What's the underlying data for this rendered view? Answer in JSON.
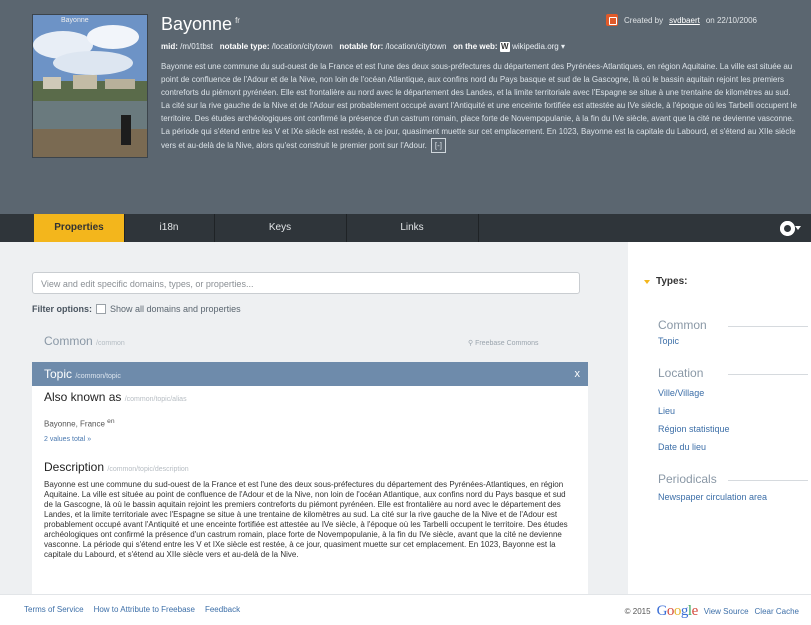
{
  "header": {
    "title": "Bayonne",
    "title_sup": "fr",
    "created_prefix": "Created by",
    "created_user": "svdbaert",
    "created_suffix": "on 22/10/2006",
    "meta": {
      "mid_label": "mid:",
      "mid_value": "/m/01tbst",
      "notable_type_label": "notable type:",
      "notable_type_value": "/location/citytown",
      "notable_for_label": "notable for:",
      "notable_for_value": "/location/citytown",
      "web_label": "on the web:",
      "web_value": "wikipedia.org"
    },
    "description": "Bayonne est une commune du sud-ouest de la France et est l'une des deux sous-préfectures du département des Pyrénées-Atlantiques, en région Aquitaine. La ville est située au point de confluence de l'Adour et de la Nive, non loin de l'océan Atlantique, aux confins nord du Pays basque et sud de la Gascogne, là où le bassin aquitain rejoint les premiers contreforts du piémont pyrénéen. Elle est frontalière au nord avec le département des Landes, et la limite territoriale avec l'Espagne se situe à une trentaine de kilomètres au sud. La cité sur la rive gauche de la Nive et de l'Adour est probablement occupé avant l'Antiquité et une enceinte fortifiée est attestée au IVe siècle, à l'époque où les Tarbelli occupent le territoire. Des études archéologiques ont confirmé la présence d'un castrum romain, place forte de Novempopulanie, à la fin du IVe siècle, avant que la cité ne devienne vasconne. La période qui s'étend entre les V et IXe siècle est restée, à ce jour, quasiment muette sur cet emplacement. En 1023, Bayonne est la capitale du Labourd, et s'étend au XIIe siècle vers et au-delà de la Nive, alors qu'est construit le premier pont sur l'Adour.",
    "more_label": "[-]"
  },
  "tabs": [
    {
      "label": "Properties",
      "active": true
    },
    {
      "label": "i18n",
      "active": false
    },
    {
      "label": "Keys",
      "active": false
    },
    {
      "label": "Links",
      "active": false
    }
  ],
  "main": {
    "search_placeholder": "View and edit specific domains, types, or properties...",
    "filter_label": "Filter options:",
    "filter_checkbox_label": "Show all domains and properties",
    "common_label": "Common",
    "common_id": "/common",
    "freebase_commons": "Freebase Commons",
    "topic_label": "Topic",
    "topic_id": "/common/topic",
    "close_label": "x",
    "aka_label": "Also known as",
    "aka_id": "/common/topic/alias",
    "aka_value": "Bayonne, France",
    "aka_value_lang": "en",
    "total_label": "2 values total »",
    "desc_label": "Description",
    "desc_id": "/common/topic/description",
    "desc_text": "Bayonne est une commune du sud-ouest de la France et est l'une des deux sous-préfectures du département des Pyrénées-Atlantiques, en région Aquitaine. La ville est située au point de confluence de l'Adour et de la Nive, non loin de l'océan Atlantique, aux confins nord du Pays basque et sud de la Gascogne, là où le bassin aquitain rejoint les premiers contreforts du piémont pyrénéen. Elle est frontalière au nord avec le département des Landes, et la limite territoriale avec l'Espagne se situe à une trentaine de kilomètres au sud. La cité sur la rive gauche de la Nive et de l'Adour est probablement occupé avant l'Antiquité et une enceinte fortifiée est attestée au IVe siècle, à l'époque où les Tarbelli occupent le territoire. Des études archéologiques ont confirmé la présence d'un castrum romain, place forte de Novempopulanie, à la fin du IVe siècle, avant que la cité ne devienne vasconne. La période qui s'étend entre les V et IXe siècle est restée, à ce jour, quasiment muette sur cet emplacement. En 1023, Bayonne est la capitale du Labourd, et s'étend au XIIe siècle vers et au-delà de la Nive."
  },
  "types": {
    "heading": "Types:",
    "sections": [
      {
        "name": "Common",
        "items": [
          "Topic"
        ]
      },
      {
        "name": "Location",
        "items": [
          "Ville/Village",
          "Lieu",
          "Région statistique",
          "Date du lieu"
        ]
      },
      {
        "name": "Periodicals",
        "items": [
          "Newspaper circulation area"
        ]
      }
    ]
  },
  "footer": {
    "links": [
      "Terms of Service",
      "How to Attribute to Freebase",
      "Feedback"
    ],
    "copyright": "© 2015",
    "google": [
      "G",
      "o",
      "o",
      "g",
      "l",
      "e"
    ],
    "view_source": "View Source",
    "clear_cache": "Clear Cache"
  },
  "colors": {
    "header_bg": "#5b6670",
    "tab_active": "#f3b61c",
    "topic_bar": "#6e8bab",
    "link": "#3d6fa8"
  }
}
